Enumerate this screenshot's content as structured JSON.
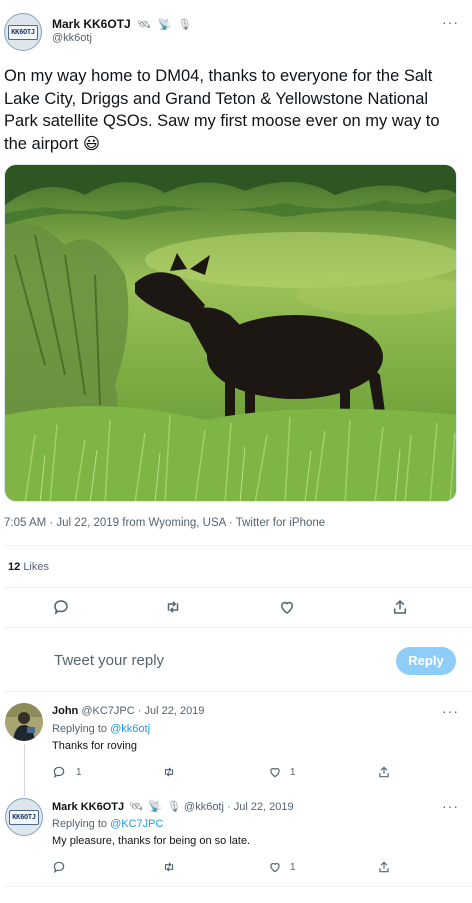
{
  "tweet": {
    "author_name": "Mark KK6OTJ",
    "handle": "@kk6otj",
    "badges": [
      "satellite-icon",
      "satellite-icon",
      "microphone-icon"
    ],
    "avatar_plate": "KK6OTJ",
    "text": "On my way home to DM04, thanks to everyone for the Salt Lake City, Driggs and Grand Teton & Yellowstone National Park satellite QSOs. Saw my first moose ever on my way to the airport 😃",
    "meta": "7:05 AM · Jul 22, 2019 from Wyoming, USA · Twitter for iPhone",
    "likes_count": "12",
    "likes_label": "Likes"
  },
  "compose": {
    "placeholder": "Tweet your reply",
    "reply_button": "Reply"
  },
  "replies": [
    {
      "author_name": "John",
      "handle": "@KC7JPC",
      "date": "· Jul 22, 2019",
      "replying_prefix": "Replying to",
      "replying_to": "@kk6otj",
      "text": "Thanks for roving",
      "reply_count": "1",
      "like_count": "1"
    },
    {
      "author_name": "Mark KK6OTJ",
      "handle": "@kk6otj",
      "date": "· Jul 22, 2019",
      "avatar_plate": "KK6OTJ",
      "replying_prefix": "Replying to",
      "replying_to": "@KC7JPC",
      "text": "My pleasure, thanks for being on so late.",
      "reply_count": "",
      "like_count": "1"
    }
  ],
  "colors": {
    "accent": "#1d9bf0",
    "reply_button": "#8ecdf8",
    "text": "#0f1419",
    "muted": "#536471"
  }
}
